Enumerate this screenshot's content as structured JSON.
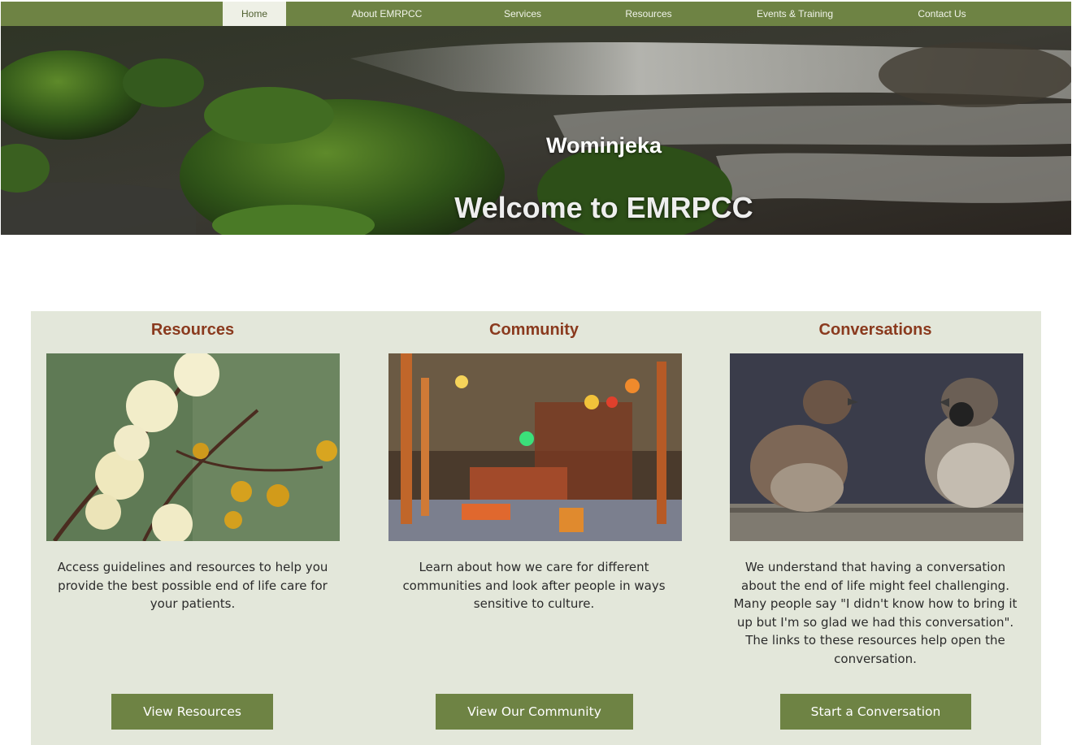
{
  "nav": {
    "items": [
      {
        "label": "Home",
        "active": true
      },
      {
        "label": "About EMRPCC"
      },
      {
        "label": "Services"
      },
      {
        "label": "Resources"
      },
      {
        "label": "Events & Training"
      },
      {
        "label": "Contact Us"
      }
    ],
    "color": "#6e8344"
  },
  "hero": {
    "subtitle": "Wominjeka",
    "title": "Welcome to EMRPCC"
  },
  "cards": [
    {
      "heading": "Resources",
      "text": "Access guidelines and resources to help you provide the best possible end of life care for your patients.",
      "button": "View Resources"
    },
    {
      "heading": "Community",
      "text": "Learn about how we care for different communities and look after people in ways sensitive to culture.",
      "button": "View Our Community"
    },
    {
      "heading": "Conversations",
      "text": "We understand that having a conversation about the end of life might feel challenging. Many people say \"I didn't know how to bring it up but I'm so glad we had this conversation\". The links to these resources help open the conversation.",
      "button": "Start a Conversation"
    }
  ],
  "colors": {
    "heading": "#8a3a1e",
    "panel": "#e3e7da",
    "button": "#6e8344"
  }
}
